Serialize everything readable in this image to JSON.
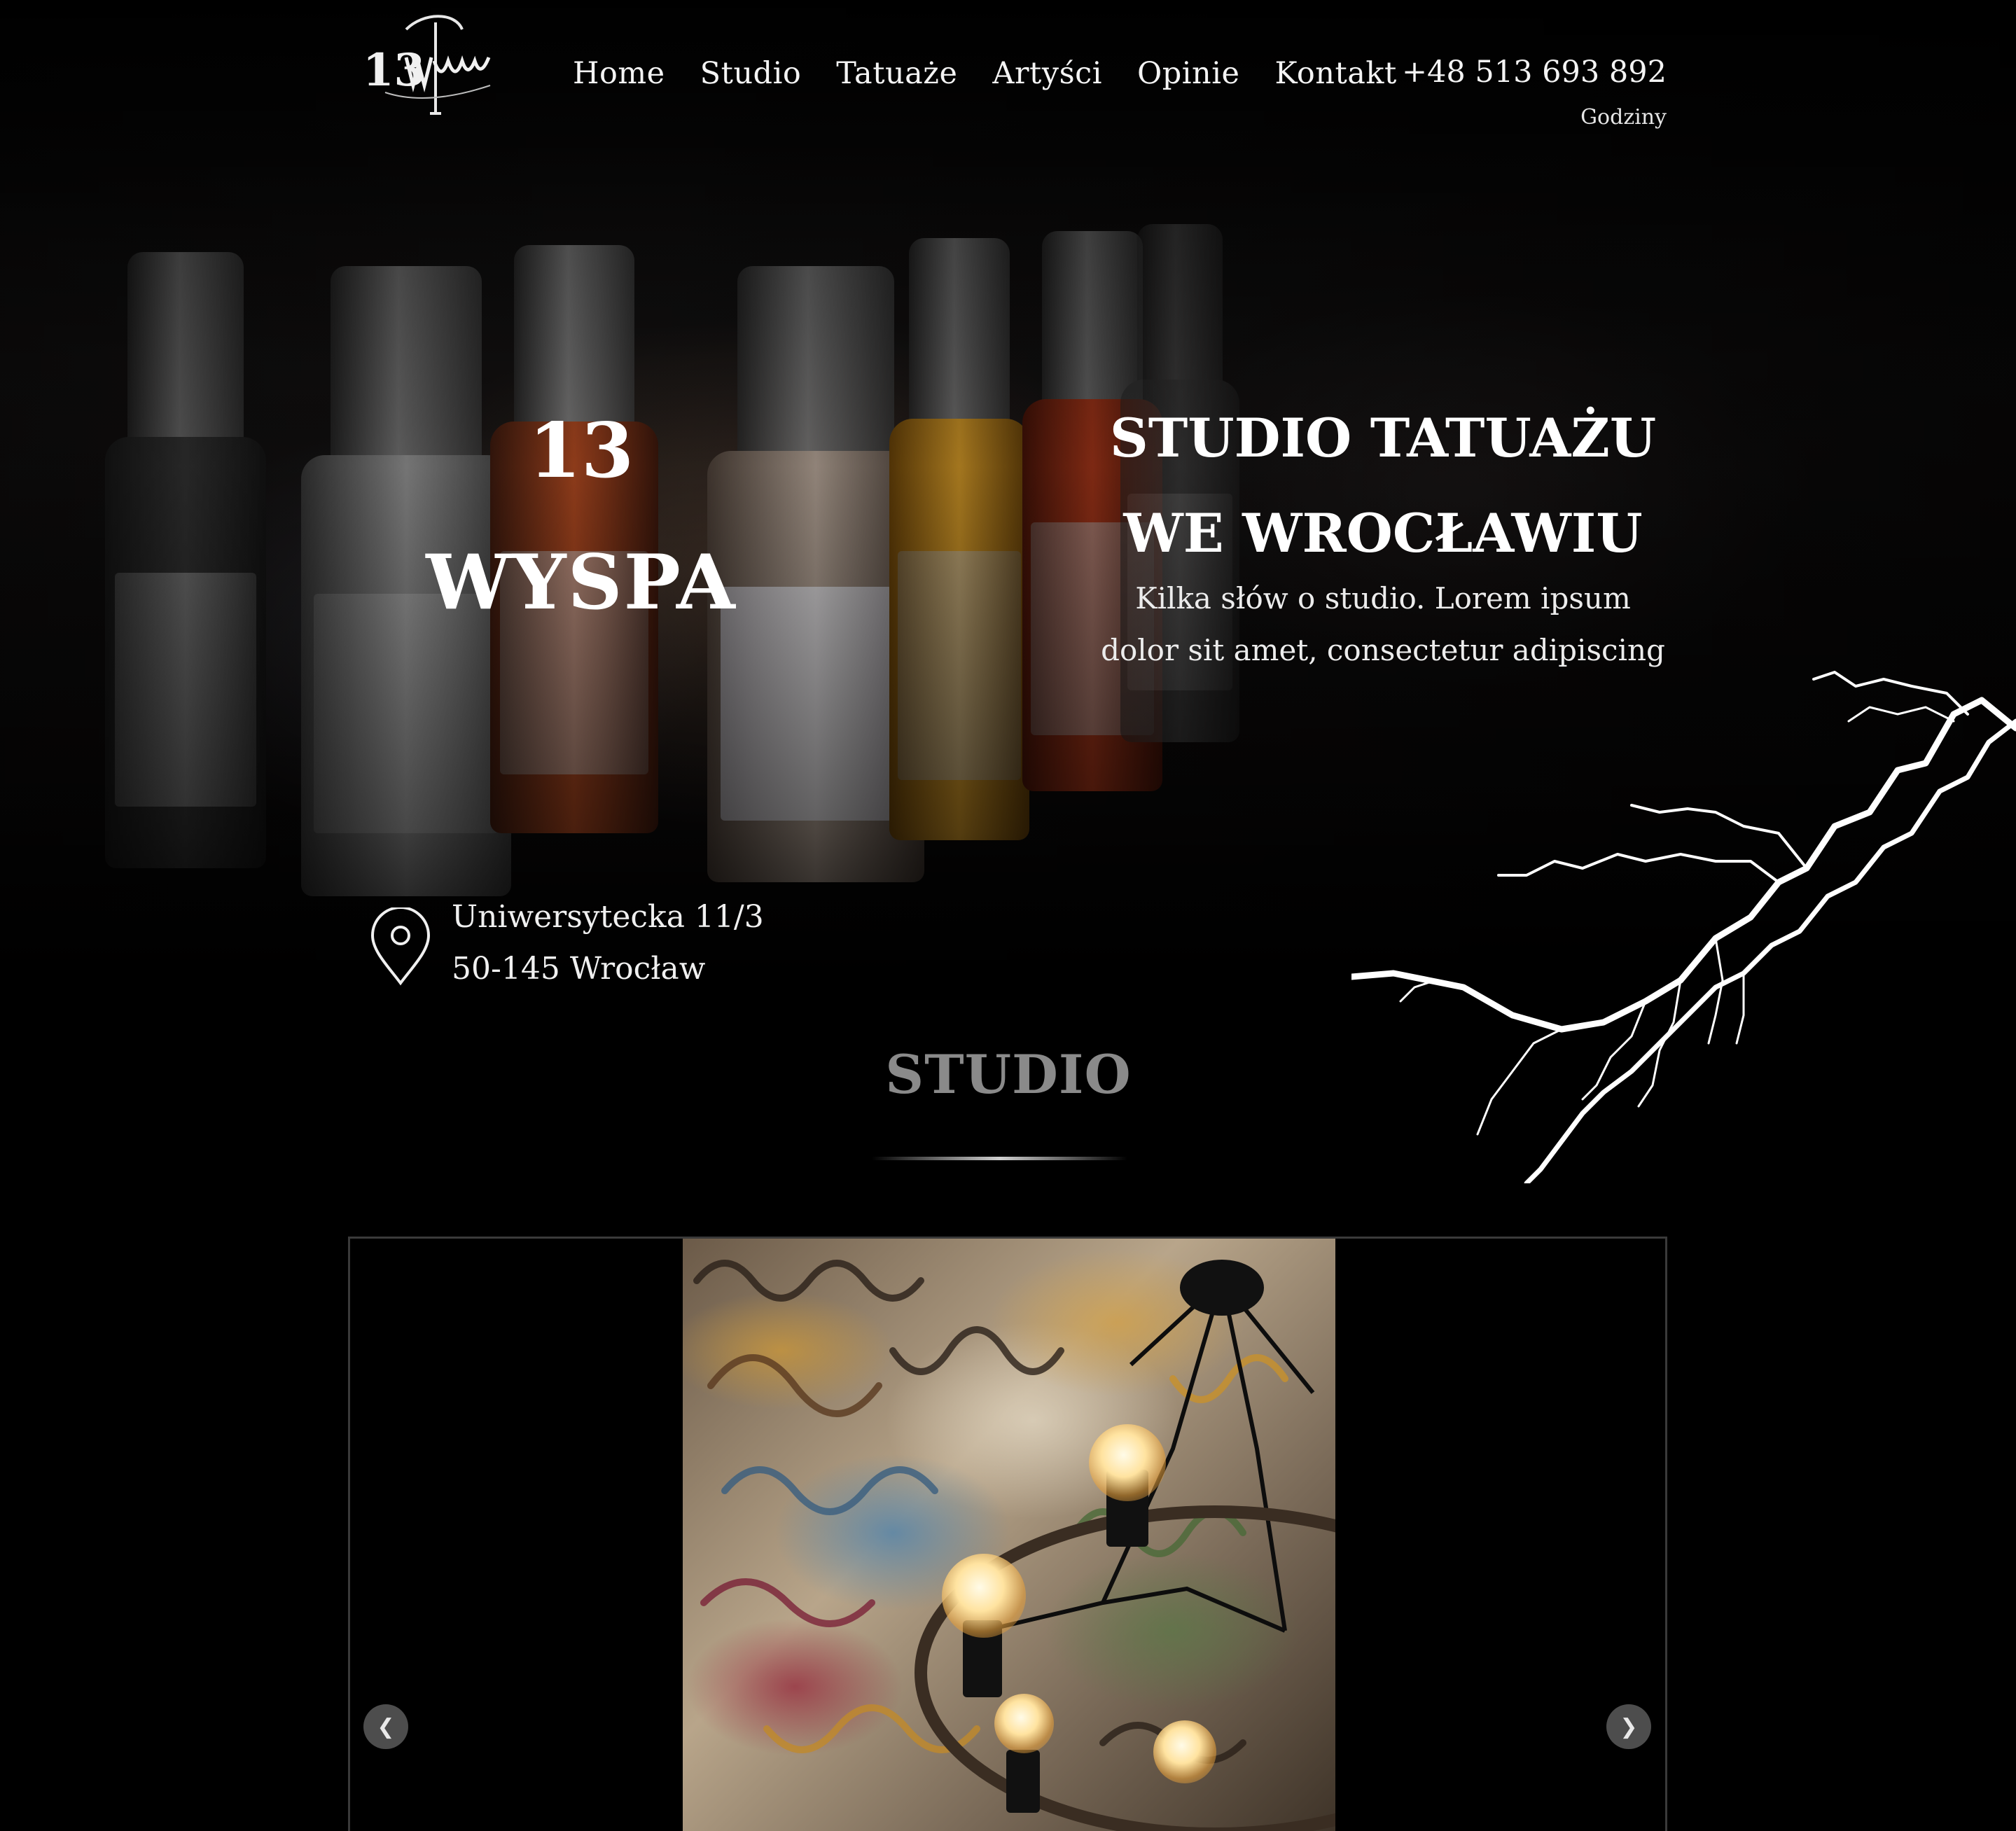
{
  "header": {
    "logo_text": "13 Wyspa",
    "nav": [
      "Home",
      "Studio",
      "Tatuaże",
      "Artyści",
      "Opinie",
      "Kontakt"
    ],
    "phone": "+48 513 693 892",
    "hours_link": "Godziny"
  },
  "hero": {
    "number": "13",
    "name": "WYSPA",
    "heading_line1": "STUDIO TATUAŻU",
    "heading_line2": "WE WROCŁAWIU",
    "description_line1": "Kilka słów o studio. Lorem ipsum",
    "description_line2": "dolor sit amet, consectetur adipiscing",
    "address_line1": "Uniwersytecka 11/3",
    "address_line2": "50-145 Wrocław",
    "address_icon": "map-pin-icon"
  },
  "studio_section": {
    "title": "STUDIO"
  },
  "gallery": {
    "prev_icon": "chevron-left-icon",
    "next_icon": "chevron-right-icon",
    "prev_glyph": "❮",
    "next_glyph": "❯"
  },
  "colors": {
    "background": "#000000",
    "text": "#f2f2f2",
    "section_title": "#8a8a8a",
    "arrow_bg": "#5a5a5a"
  }
}
